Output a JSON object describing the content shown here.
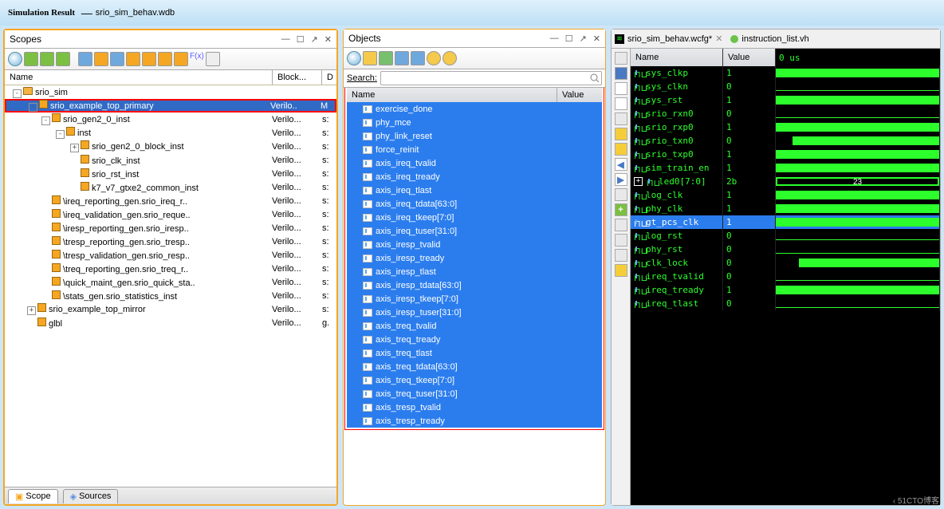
{
  "title_bold": "Simulation Result",
  "title_file": "srio_sim_behav.wdb",
  "watermark": "‹ 51CTO博客",
  "scopes": {
    "title": "Scopes",
    "col_name": "Name",
    "col_block": "Block...",
    "col_d": "D",
    "tab_scope": "Scope",
    "tab_sources": "Sources",
    "tree": [
      {
        "indent": 0,
        "exp": "-",
        "icon": "fold",
        "name": "srio_sim",
        "blk": "",
        "d": "",
        "sel": false
      },
      {
        "indent": 1,
        "exp": "-",
        "icon": "box",
        "name": "srio_example_top_primary",
        "blk": "Verilo..",
        "d": "M",
        "sel": true,
        "red": true
      },
      {
        "indent": 2,
        "exp": "-",
        "icon": "box",
        "name": "srio_gen2_0_inst",
        "blk": "Verilo...",
        "d": "s:",
        "sel": false
      },
      {
        "indent": 3,
        "exp": "-",
        "icon": "box",
        "name": "inst",
        "blk": "Verilo...",
        "d": "s:",
        "sel": false
      },
      {
        "indent": 4,
        "exp": "+",
        "icon": "box",
        "name": "srio_gen2_0_block_inst",
        "blk": "Verilo...",
        "d": "s:",
        "sel": false
      },
      {
        "indent": 4,
        "exp": "",
        "icon": "box",
        "name": "srio_clk_inst",
        "blk": "Verilo...",
        "d": "s:",
        "sel": false
      },
      {
        "indent": 4,
        "exp": "",
        "icon": "box",
        "name": "srio_rst_inst",
        "blk": "Verilo...",
        "d": "s:",
        "sel": false
      },
      {
        "indent": 4,
        "exp": "",
        "icon": "box",
        "name": "k7_v7_gtxe2_common_inst",
        "blk": "Verilo...",
        "d": "s:",
        "sel": false
      },
      {
        "indent": 2,
        "exp": "",
        "icon": "box",
        "name": "\\ireq_reporting_gen.srio_ireq_r..",
        "blk": "Verilo...",
        "d": "s:",
        "sel": false
      },
      {
        "indent": 2,
        "exp": "",
        "icon": "box",
        "name": "\\ireq_validation_gen.srio_reque..",
        "blk": "Verilo...",
        "d": "s:",
        "sel": false
      },
      {
        "indent": 2,
        "exp": "",
        "icon": "box",
        "name": "\\iresp_reporting_gen.srio_iresp..",
        "blk": "Verilo...",
        "d": "s:",
        "sel": false
      },
      {
        "indent": 2,
        "exp": "",
        "icon": "box",
        "name": "\\tresp_reporting_gen.srio_tresp..",
        "blk": "Verilo...",
        "d": "s:",
        "sel": false
      },
      {
        "indent": 2,
        "exp": "",
        "icon": "box",
        "name": "\\tresp_validation_gen.srio_resp..",
        "blk": "Verilo...",
        "d": "s:",
        "sel": false
      },
      {
        "indent": 2,
        "exp": "",
        "icon": "box",
        "name": "\\treq_reporting_gen.srio_treq_r..",
        "blk": "Verilo...",
        "d": "s:",
        "sel": false
      },
      {
        "indent": 2,
        "exp": "",
        "icon": "box",
        "name": "\\quick_maint_gen.srio_quick_sta..",
        "blk": "Verilo...",
        "d": "s:",
        "sel": false
      },
      {
        "indent": 2,
        "exp": "",
        "icon": "box",
        "name": "\\stats_gen.srio_statistics_inst",
        "blk": "Verilo...",
        "d": "s:",
        "sel": false
      },
      {
        "indent": 1,
        "exp": "+",
        "icon": "box",
        "name": "srio_example_top_mirror",
        "blk": "Verilo...",
        "d": "s:",
        "sel": false
      },
      {
        "indent": 1,
        "exp": "",
        "icon": "box",
        "name": "glbl",
        "blk": "Verilo...",
        "d": "g.",
        "sel": false
      }
    ]
  },
  "objects": {
    "title": "Objects",
    "search_label": "Search:",
    "col_name": "Name",
    "col_value": "Value",
    "items": [
      "exercise_done",
      "phy_mce",
      "phy_link_reset",
      "force_reinit",
      "axis_ireq_tvalid",
      "axis_ireq_tready",
      "axis_ireq_tlast",
      "axis_ireq_tdata[63:0]",
      "axis_ireq_tkeep[7:0]",
      "axis_ireq_tuser[31:0]",
      "axis_iresp_tvalid",
      "axis_iresp_tready",
      "axis_iresp_tlast",
      "axis_iresp_tdata[63:0]",
      "axis_iresp_tkeep[7:0]",
      "axis_iresp_tuser[31:0]",
      "axis_treq_tvalid",
      "axis_treq_tready",
      "axis_treq_tlast",
      "axis_treq_tdata[63:0]",
      "axis_treq_tkeep[7:0]",
      "axis_treq_tuser[31:0]",
      "axis_tresp_tvalid",
      "axis_tresp_tready"
    ]
  },
  "wave": {
    "tab1": "srio_sim_behav.wcfg*",
    "tab2": "instruction_list.vh",
    "col_name": "Name",
    "col_value": "Value",
    "time_hdr": "0 us",
    "signals": [
      {
        "name": "sys_clkp",
        "val": "1",
        "type": "hi"
      },
      {
        "name": "sys_clkn",
        "val": "0",
        "type": "lo"
      },
      {
        "name": "sys_rst",
        "val": "1",
        "type": "hi"
      },
      {
        "name": "srio_rxn0",
        "val": "0",
        "type": "lo"
      },
      {
        "name": "srio_rxp0",
        "val": "1",
        "type": "hi"
      },
      {
        "name": "srio_txn0",
        "val": "0",
        "type": "hi_half"
      },
      {
        "name": "srio_txp0",
        "val": "1",
        "type": "hi"
      },
      {
        "name": "sim_train_en",
        "val": "1",
        "type": "hi"
      },
      {
        "name": "led0[7:0]",
        "val": "2b",
        "type": "box",
        "box": "23",
        "exp": "+"
      },
      {
        "name": "log_clk",
        "val": "1",
        "type": "hi"
      },
      {
        "name": "phy_clk",
        "val": "1",
        "type": "hi"
      },
      {
        "name": "gt_pcs_clk",
        "val": "1",
        "type": "hi",
        "sel": true
      },
      {
        "name": "log_rst",
        "val": "0",
        "type": "lo"
      },
      {
        "name": "phy_rst",
        "val": "0",
        "type": "lo"
      },
      {
        "name": "clk_lock",
        "val": "0",
        "type": "hi_half2"
      },
      {
        "name": "ireq_tvalid",
        "val": "0",
        "type": "lo"
      },
      {
        "name": "ireq_tready",
        "val": "1",
        "type": "hi"
      },
      {
        "name": "ireq_tlast",
        "val": "0",
        "type": "lo"
      }
    ]
  }
}
